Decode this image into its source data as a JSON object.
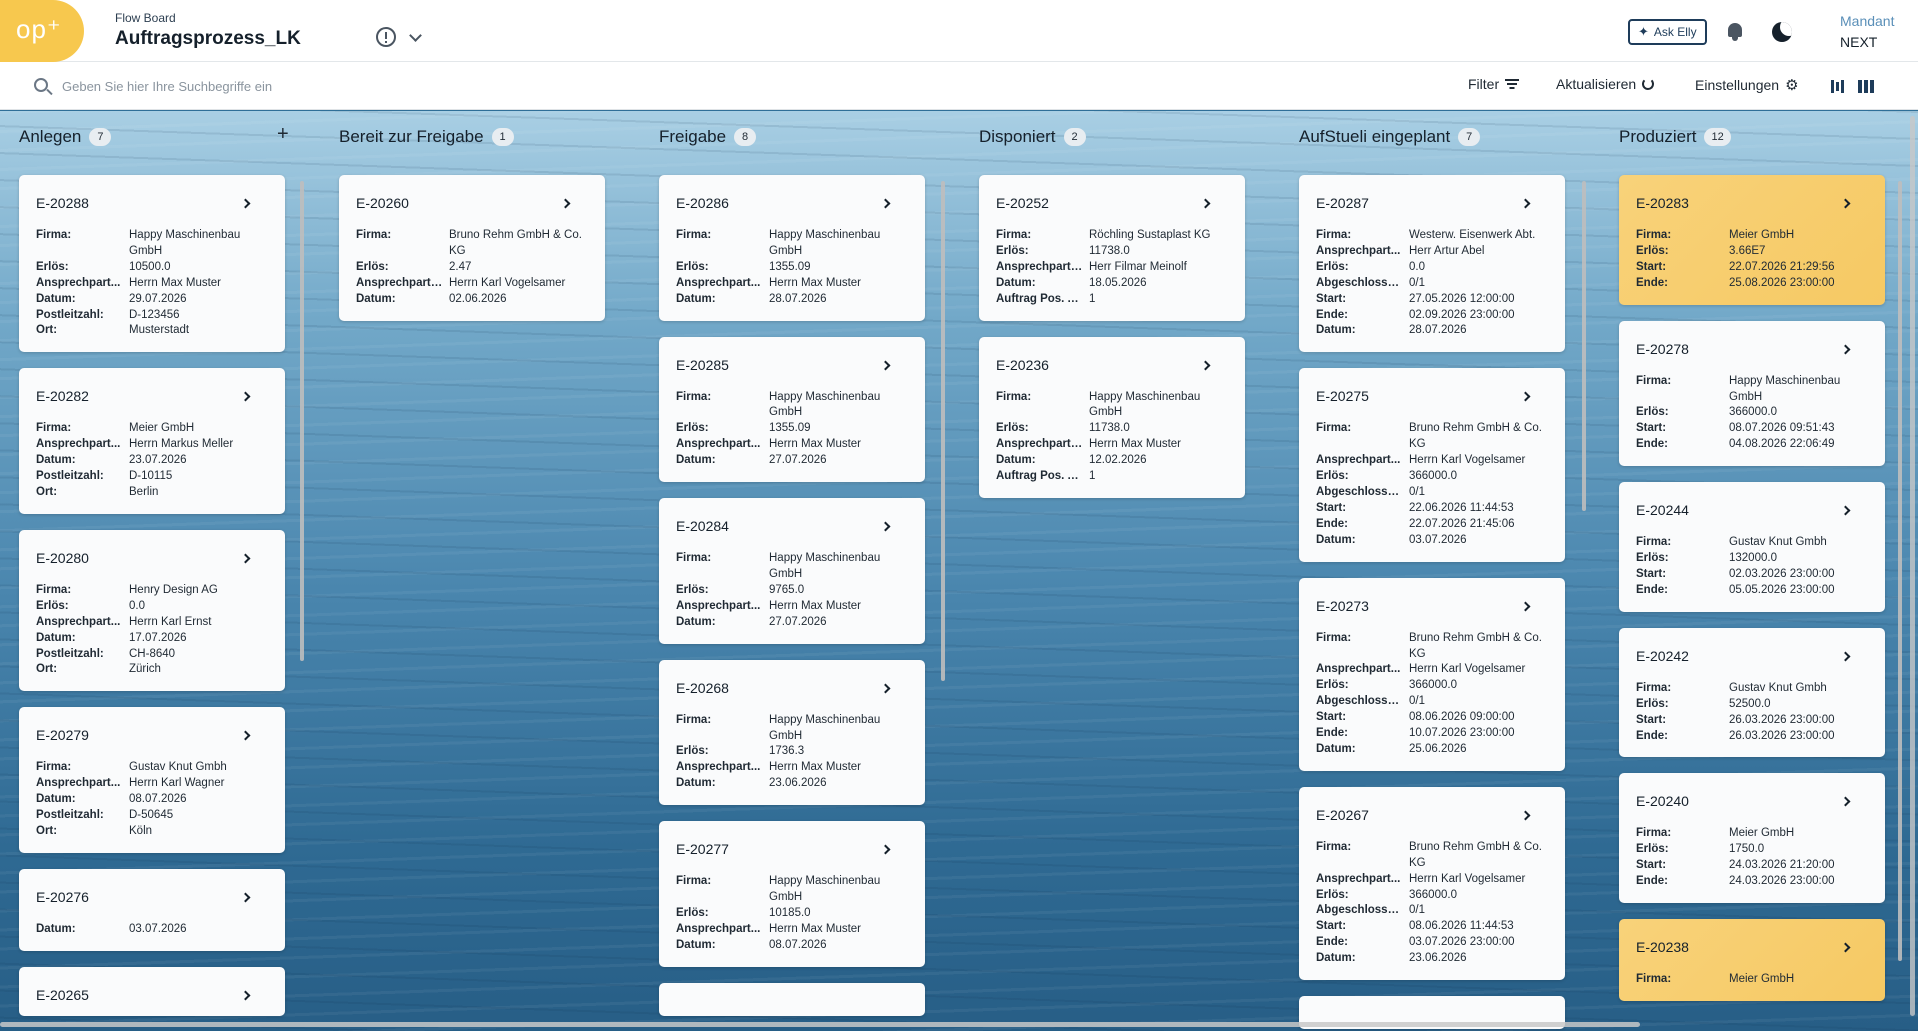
{
  "header": {
    "logo_text": "op⁺",
    "breadcrumb": "Flow Board",
    "title": "Auftragsprozess_LK",
    "ask_elly": "Ask Elly",
    "mandant_label": "Mandant",
    "mandant_value": "NEXT"
  },
  "toolbar": {
    "search_placeholder": "Geben Sie hier Ihre Suchbegriffe ein",
    "filter": "Filter",
    "refresh": "Aktualisieren",
    "settings": "Einstellungen"
  },
  "columns": [
    {
      "title": "Anlegen",
      "count": "7",
      "add": "+",
      "cards": [
        {
          "id": "E-20288",
          "fields": [
            [
              "Firma:",
              "Happy Maschinenbau GmbH"
            ],
            [
              "Erlös:",
              "10500.0"
            ],
            [
              "Ansprechpart...",
              "Herrn Max Muster"
            ],
            [
              "Datum:",
              "29.07.2026"
            ],
            [
              "Postleitzahl:",
              "D-123456"
            ],
            [
              "Ort:",
              "Musterstadt"
            ]
          ]
        },
        {
          "id": "E-20282",
          "fields": [
            [
              "Firma:",
              "Meier GmbH"
            ],
            [
              "Ansprechpart...",
              "Herrn Markus Meller"
            ],
            [
              "Datum:",
              "23.07.2026"
            ],
            [
              "Postleitzahl:",
              "D-10115"
            ],
            [
              "Ort:",
              "Berlin"
            ]
          ]
        },
        {
          "id": "E-20280",
          "fields": [
            [
              "Firma:",
              "Henry Design AG"
            ],
            [
              "Erlös:",
              "0.0"
            ],
            [
              "Ansprechpart...",
              "Herrn Karl Ernst"
            ],
            [
              "Datum:",
              "17.07.2026"
            ],
            [
              "Postleitzahl:",
              "CH-8640"
            ],
            [
              "Ort:",
              "Zürich"
            ]
          ]
        },
        {
          "id": "E-20279",
          "fields": [
            [
              "Firma:",
              "Gustav Knut Gmbh"
            ],
            [
              "Ansprechpart...",
              "Herrn Karl Wagner"
            ],
            [
              "Datum:",
              "08.07.2026"
            ],
            [
              "Postleitzahl:",
              "D-50645"
            ],
            [
              "Ort:",
              "Köln"
            ]
          ]
        },
        {
          "id": "E-20276",
          "fields": [
            [
              "Datum:",
              "03.07.2026"
            ]
          ]
        },
        {
          "id": "E-20265",
          "fields": []
        }
      ]
    },
    {
      "title": "Bereit zur Freigabe",
      "count": "1",
      "cards": [
        {
          "id": "E-20260",
          "fields": [
            [
              "Firma:",
              "Bruno Rehm GmbH & Co. KG"
            ],
            [
              "Erlös:",
              "2.47"
            ],
            [
              "Ansprechpartn...",
              "Herrn Karl Vogelsamer"
            ],
            [
              "Datum:",
              "02.06.2026"
            ]
          ]
        }
      ]
    },
    {
      "title": "Freigabe",
      "count": "8",
      "cards": [
        {
          "id": "E-20286",
          "fields": [
            [
              "Firma:",
              "Happy Maschinenbau GmbH"
            ],
            [
              "Erlös:",
              "1355.09"
            ],
            [
              "Ansprechpart...",
              "Herrn Max Muster"
            ],
            [
              "Datum:",
              "28.07.2026"
            ]
          ]
        },
        {
          "id": "E-20285",
          "fields": [
            [
              "Firma:",
              "Happy Maschinenbau GmbH"
            ],
            [
              "Erlös:",
              "1355.09"
            ],
            [
              "Ansprechpart...",
              "Herrn Max Muster"
            ],
            [
              "Datum:",
              "27.07.2026"
            ]
          ]
        },
        {
          "id": "E-20284",
          "fields": [
            [
              "Firma:",
              "Happy Maschinenbau GmbH"
            ],
            [
              "Erlös:",
              "9765.0"
            ],
            [
              "Ansprechpart...",
              "Herrn Max Muster"
            ],
            [
              "Datum:",
              "27.07.2026"
            ]
          ]
        },
        {
          "id": "E-20268",
          "fields": [
            [
              "Firma:",
              "Happy Maschinenbau GmbH"
            ],
            [
              "Erlös:",
              "1736.3"
            ],
            [
              "Ansprechpart...",
              "Herrn Max Muster"
            ],
            [
              "Datum:",
              "23.06.2026"
            ]
          ]
        },
        {
          "id": "E-20277",
          "fields": [
            [
              "Firma:",
              "Happy Maschinenbau GmbH"
            ],
            [
              "Erlös:",
              "10185.0"
            ],
            [
              "Ansprechpart...",
              "Herrn Max Muster"
            ],
            [
              "Datum:",
              "08.07.2026"
            ]
          ]
        },
        {
          "id": "",
          "fields": []
        }
      ]
    },
    {
      "title": "Disponiert",
      "count": "2",
      "cards": [
        {
          "id": "E-20252",
          "fields": [
            [
              "Firma:",
              "Röchling Sustaplast KG"
            ],
            [
              "Erlös:",
              "11738.0"
            ],
            [
              "Ansprechpartn...",
              "Herr Filmar Meinolf"
            ],
            [
              "Datum:",
              "18.05.2026"
            ],
            [
              "Auftrag Pos. A...",
              "1"
            ]
          ]
        },
        {
          "id": "E-20236",
          "fields": [
            [
              "Firma:",
              "Happy Maschinenbau GmbH"
            ],
            [
              "Erlös:",
              "11738.0"
            ],
            [
              "Ansprechpartn...",
              "Herrn Max Muster"
            ],
            [
              "Datum:",
              "12.02.2026"
            ],
            [
              "Auftrag Pos. A...",
              "1"
            ]
          ]
        }
      ]
    },
    {
      "title": "AufStueli eingeplant",
      "count": "7",
      "cards": [
        {
          "id": "E-20287",
          "fields": [
            [
              "Firma:",
              "Westerw. Eisenwerk Abt."
            ],
            [
              "Ansprechpart...",
              "Herr Artur Abel"
            ],
            [
              "Erlös:",
              "0.0"
            ],
            [
              "Abgeschlossen:",
              "0/1"
            ],
            [
              "Start:",
              "27.05.2026 12:00:00"
            ],
            [
              "Ende:",
              "02.09.2026 23:00:00"
            ],
            [
              "Datum:",
              "28.07.2026"
            ]
          ]
        },
        {
          "id": "E-20275",
          "fields": [
            [
              "Firma:",
              "Bruno Rehm GmbH & Co. KG"
            ],
            [
              "Ansprechpart...",
              "Herrn Karl Vogelsamer"
            ],
            [
              "Erlös:",
              "366000.0"
            ],
            [
              "Abgeschlossen:",
              "0/1"
            ],
            [
              "Start:",
              "22.06.2026 11:44:53"
            ],
            [
              "Ende:",
              "22.07.2026 21:45:06"
            ],
            [
              "Datum:",
              "03.07.2026"
            ]
          ]
        },
        {
          "id": "E-20273",
          "fields": [
            [
              "Firma:",
              "Bruno Rehm GmbH & Co. KG"
            ],
            [
              "Ansprechpart...",
              "Herrn Karl Vogelsamer"
            ],
            [
              "Erlös:",
              "366000.0"
            ],
            [
              "Abgeschlossen:",
              "0/1"
            ],
            [
              "Start:",
              "08.06.2026 09:00:00"
            ],
            [
              "Ende:",
              "10.07.2026 23:00:00"
            ],
            [
              "Datum:",
              "25.06.2026"
            ]
          ]
        },
        {
          "id": "E-20267",
          "fields": [
            [
              "Firma:",
              "Bruno Rehm GmbH & Co. KG"
            ],
            [
              "Ansprechpart...",
              "Herrn Karl Vogelsamer"
            ],
            [
              "Erlös:",
              "366000.0"
            ],
            [
              "Abgeschlossen:",
              "0/1"
            ],
            [
              "Start:",
              "08.06.2026 11:44:53"
            ],
            [
              "Ende:",
              "03.07.2026 23:00:00"
            ],
            [
              "Datum:",
              "23.06.2026"
            ]
          ]
        },
        {
          "id": "",
          "fields": []
        }
      ]
    },
    {
      "title": "Produziert",
      "count": "12",
      "cards": [
        {
          "id": "E-20283",
          "highlight": true,
          "fields": [
            [
              "Firma:",
              "Meier GmbH"
            ],
            [
              "Erlös:",
              "3.66E7"
            ],
            [
              "Start:",
              "22.07.2026 21:29:56"
            ],
            [
              "Ende:",
              "25.08.2026 23:00:00"
            ]
          ]
        },
        {
          "id": "E-20278",
          "fields": [
            [
              "Firma:",
              "Happy Maschinenbau GmbH"
            ],
            [
              "Erlös:",
              "366000.0"
            ],
            [
              "Start:",
              "08.07.2026 09:51:43"
            ],
            [
              "Ende:",
              "04.08.2026 22:06:49"
            ]
          ]
        },
        {
          "id": "E-20244",
          "fields": [
            [
              "Firma:",
              "Gustav Knut Gmbh"
            ],
            [
              "Erlös:",
              "132000.0"
            ],
            [
              "Start:",
              "02.03.2026 23:00:00"
            ],
            [
              "Ende:",
              "05.05.2026 23:00:00"
            ]
          ]
        },
        {
          "id": "E-20242",
          "fields": [
            [
              "Firma:",
              "Gustav Knut Gmbh"
            ],
            [
              "Erlös:",
              "52500.0"
            ],
            [
              "Start:",
              "26.03.2026 23:00:00"
            ],
            [
              "Ende:",
              "26.03.2026 23:00:00"
            ]
          ]
        },
        {
          "id": "E-20240",
          "fields": [
            [
              "Firma:",
              "Meier GmbH"
            ],
            [
              "Erlös:",
              "1750.0"
            ],
            [
              "Start:",
              "24.03.2026 21:20:00"
            ],
            [
              "Ende:",
              "24.03.2026 23:00:00"
            ]
          ]
        },
        {
          "id": "E-20238",
          "highlight": true,
          "fields": [
            [
              "Firma:",
              "Meier GmbH"
            ]
          ]
        }
      ]
    }
  ]
}
